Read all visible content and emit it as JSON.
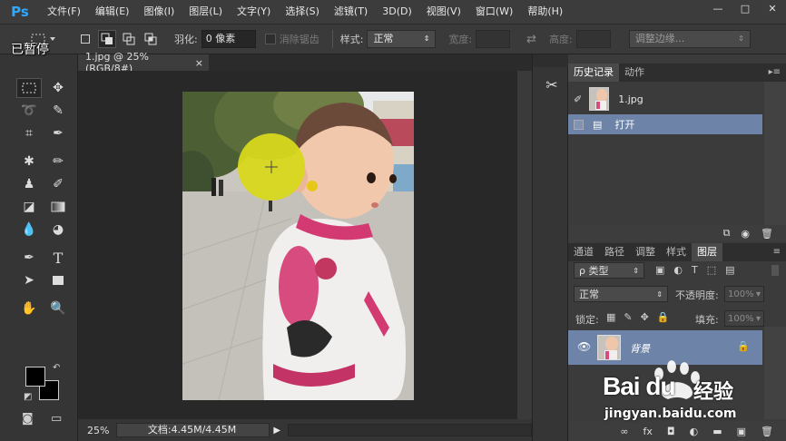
{
  "app": {
    "logo": "Ps"
  },
  "menu": [
    "文件(F)",
    "编辑(E)",
    "图像(I)",
    "图层(L)",
    "文字(Y)",
    "选择(S)",
    "滤镜(T)",
    "3D(D)",
    "视图(V)",
    "窗口(W)",
    "帮助(H)"
  ],
  "window_controls": {
    "minimize": "—",
    "maximize": "□",
    "close": "✕"
  },
  "options": {
    "feather_label": "羽化:",
    "feather_value": "0 像素",
    "antialias_label": "消除锯齿",
    "style_label": "样式:",
    "style_value": "正常",
    "width_label": "宽度:",
    "height_label": "高度:",
    "refine_edge": "调整边缘..."
  },
  "overlay": {
    "pause_text": "已暂停"
  },
  "document": {
    "tab_title": "1.jpg @ 25%(RGB/8#)",
    "tab_close": "×",
    "zoom": "25%",
    "doc_info": "文档:4.45M/4.45M",
    "status_arrow": "▶"
  },
  "history_panel": {
    "tabs": [
      "历史记录",
      "动作"
    ],
    "snapshot_name": "1.jpg",
    "steps": [
      "打开"
    ]
  },
  "layers_panel": {
    "tabs": [
      "通道",
      "路径",
      "调整",
      "样式",
      "图层"
    ],
    "filter_kind": "ρ 类型",
    "blend_mode": "正常",
    "opacity_label": "不透明度:",
    "opacity_value": "100%",
    "lock_label": "锁定:",
    "fill_label": "填充:",
    "fill_value": "100%",
    "layers": [
      {
        "name": "背景",
        "locked": true,
        "visible": true
      }
    ],
    "bottom_icons": [
      "∞",
      "fx",
      "◘",
      "◐",
      "▬",
      "▣",
      "🗑"
    ]
  },
  "watermark": {
    "brand": "Bai du",
    "brand_cn": "经验",
    "url": "jingyan.baidu.com"
  },
  "colors": {
    "accent": "#31a8ff",
    "selection": "#6d84a8",
    "brush_cursor": "#d8d81c"
  }
}
